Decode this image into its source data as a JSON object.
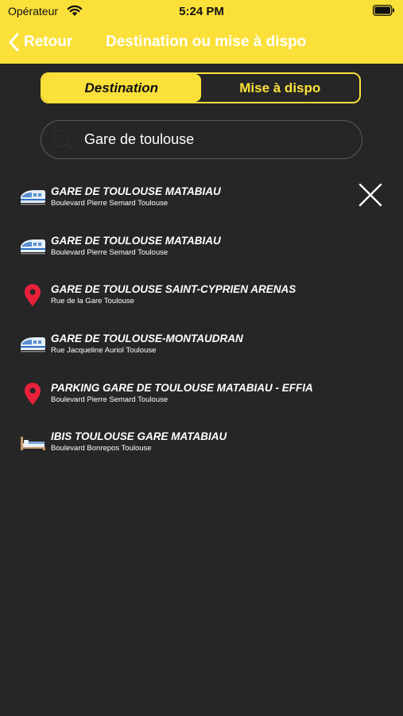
{
  "status": {
    "carrier": "Opérateur",
    "time": "5:24 PM"
  },
  "nav": {
    "back_label": "Retour",
    "title": "Destination ou mise à dispo"
  },
  "segments": [
    "Destination",
    "Mise à dispo"
  ],
  "search": {
    "value": "Gare de toulouse"
  },
  "results": [
    {
      "icon": "train-icon",
      "title": "GARE DE TOULOUSE MATABIAU",
      "subtitle": "Boulevard Pierre Semard Toulouse"
    },
    {
      "icon": "train-icon",
      "title": "GARE DE TOULOUSE MATABIAU",
      "subtitle": "Boulevard Pierre Semard Toulouse"
    },
    {
      "icon": "location-pin-icon",
      "title": "GARE DE TOULOUSE SAINT-CYPRIEN ARENAS",
      "subtitle": "Rue de la Gare Toulouse"
    },
    {
      "icon": "train-icon",
      "title": "GARE DE TOULOUSE-MONTAUDRAN",
      "subtitle": "Rue Jacqueline Auriol Toulouse"
    },
    {
      "icon": "location-pin-icon",
      "title": "PARKING GARE DE TOULOUSE MATABIAU - EFFIA",
      "subtitle": "Boulevard Pierre Semard Toulouse"
    },
    {
      "icon": "hotel-bed-icon",
      "title": "IBIS TOULOUSE GARE MATABIAU",
      "subtitle": "Boulevard Bonrepos Toulouse"
    }
  ],
  "colors": {
    "accent": "#fbe03a",
    "background": "#262626",
    "pin": "#e8203a"
  }
}
